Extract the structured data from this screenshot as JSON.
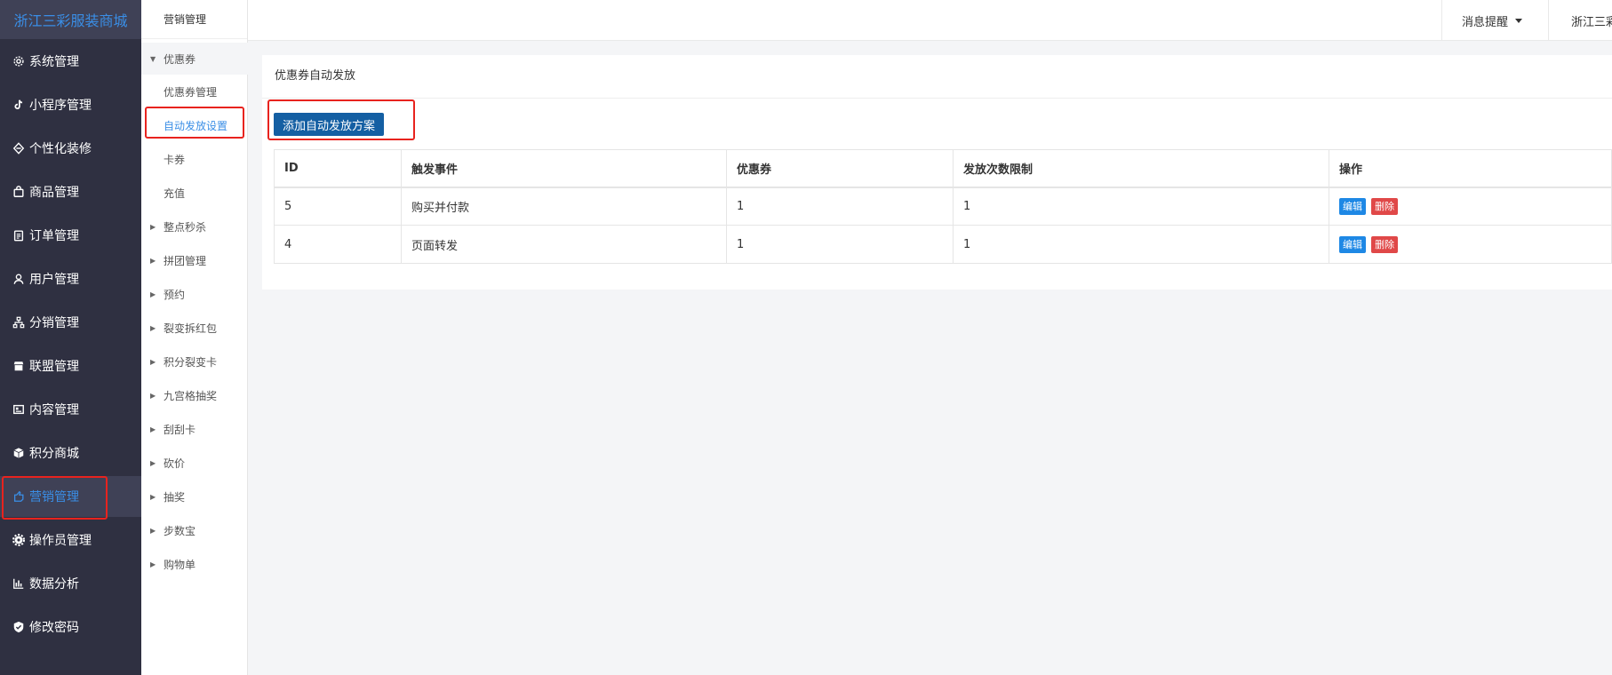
{
  "brand": "浙江三彩服装商城",
  "sidebar": {
    "items": [
      {
        "label": "系统管理",
        "icon": "gear-outline-icon"
      },
      {
        "label": "小程序管理",
        "icon": "tiktok-icon"
      },
      {
        "label": "个性化装修",
        "icon": "palette-icon"
      },
      {
        "label": "商品管理",
        "icon": "bag-icon"
      },
      {
        "label": "订单管理",
        "icon": "clipboard-icon"
      },
      {
        "label": "用户管理",
        "icon": "user-icon"
      },
      {
        "label": "分销管理",
        "icon": "org-chart-icon"
      },
      {
        "label": "联盟管理",
        "icon": "store-icon"
      },
      {
        "label": "内容管理",
        "icon": "content-icon"
      },
      {
        "label": "积分商城",
        "icon": "cube-icon"
      },
      {
        "label": "营销管理",
        "icon": "marketing-icon",
        "active": true
      },
      {
        "label": "操作员管理",
        "icon": "gear-solid-icon"
      },
      {
        "label": "数据分析",
        "icon": "bar-chart-icon"
      },
      {
        "label": "修改密码",
        "icon": "shield-check-icon"
      }
    ]
  },
  "subnav": {
    "title": "营销管理",
    "items": [
      {
        "label": "优惠券",
        "type": "group-open"
      },
      {
        "label": "优惠券管理",
        "type": "child"
      },
      {
        "label": "自动发放设置",
        "type": "child",
        "selected": true
      },
      {
        "label": "卡券",
        "type": "child"
      },
      {
        "label": "充值",
        "type": "child"
      },
      {
        "label": "整点秒杀",
        "type": "group"
      },
      {
        "label": "拼团管理",
        "type": "group"
      },
      {
        "label": "预约",
        "type": "group"
      },
      {
        "label": "裂变拆红包",
        "type": "group"
      },
      {
        "label": "积分裂变卡",
        "type": "group"
      },
      {
        "label": "九宫格抽奖",
        "type": "group"
      },
      {
        "label": "刮刮卡",
        "type": "group"
      },
      {
        "label": "砍价",
        "type": "group"
      },
      {
        "label": "抽奖",
        "type": "group"
      },
      {
        "label": "步数宝",
        "type": "group"
      },
      {
        "label": "购物单",
        "type": "group"
      }
    ]
  },
  "topbar": {
    "message": "消息提醒",
    "user": "浙江三彩服装商城"
  },
  "main": {
    "title": "优惠券自动发放",
    "add_button": "添加自动发放方案",
    "table": {
      "headers": [
        "ID",
        "触发事件",
        "优惠券",
        "发放次数限制",
        "操作"
      ],
      "rows": [
        {
          "id": "5",
          "event": "购买并付款",
          "coupon": "1",
          "limit": "1"
        },
        {
          "id": "4",
          "event": "页面转发",
          "coupon": "1",
          "limit": "1"
        }
      ],
      "edit_label": "编辑",
      "delete_label": "删除"
    }
  },
  "colors": {
    "sidebar_bg": "#2f3041",
    "accent": "#3a8ee6",
    "primary_button": "#145fa3",
    "edit_button": "#1e88e5",
    "delete_button": "#e04848",
    "highlight": "#e8231e"
  }
}
